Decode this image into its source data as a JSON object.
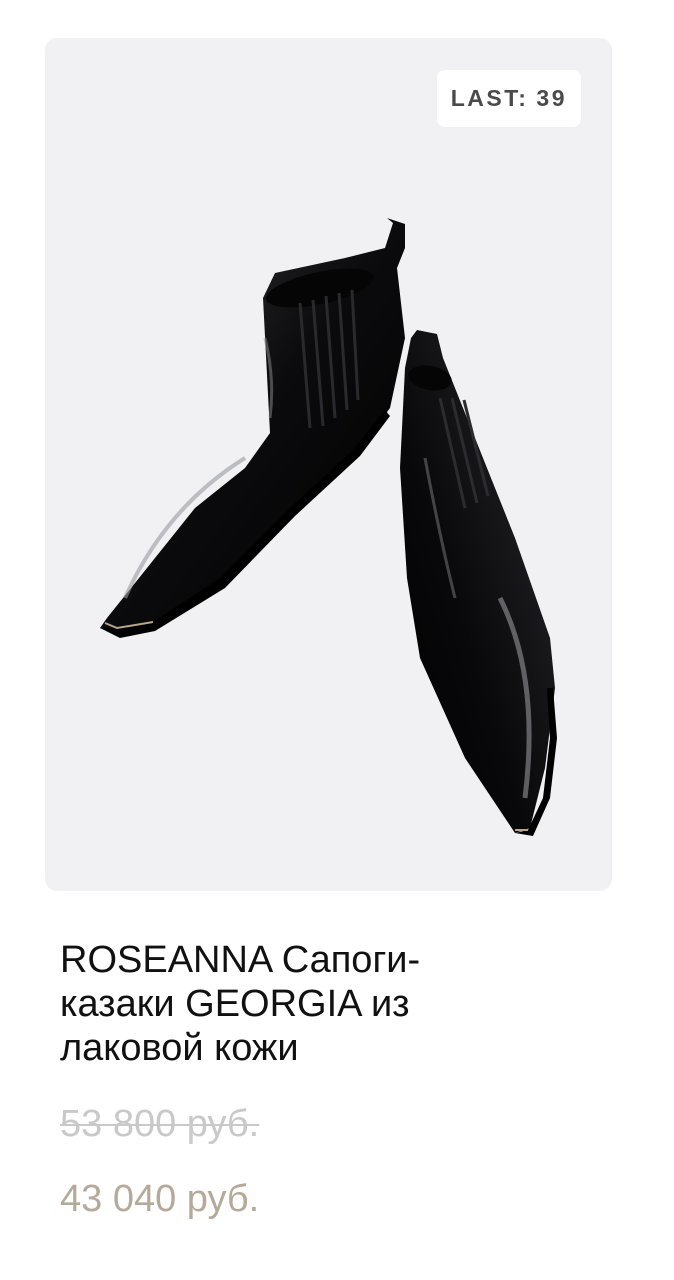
{
  "product": {
    "badge_label": "LAST:",
    "badge_value": "39",
    "image_description_name": "patent-leather-boots-photo",
    "title_line1": "ROSEANNA Сапоги-",
    "title_line2": "казаки GEORGIA из",
    "title_line3": "лаковой кожи",
    "old_price": "53 800 руб.",
    "new_price": "43 040 руб."
  },
  "colors": {
    "image_background": "#f1f1f3",
    "new_price": "#b5aa9a",
    "old_price": "#c9c9c9",
    "title": "#111111"
  }
}
